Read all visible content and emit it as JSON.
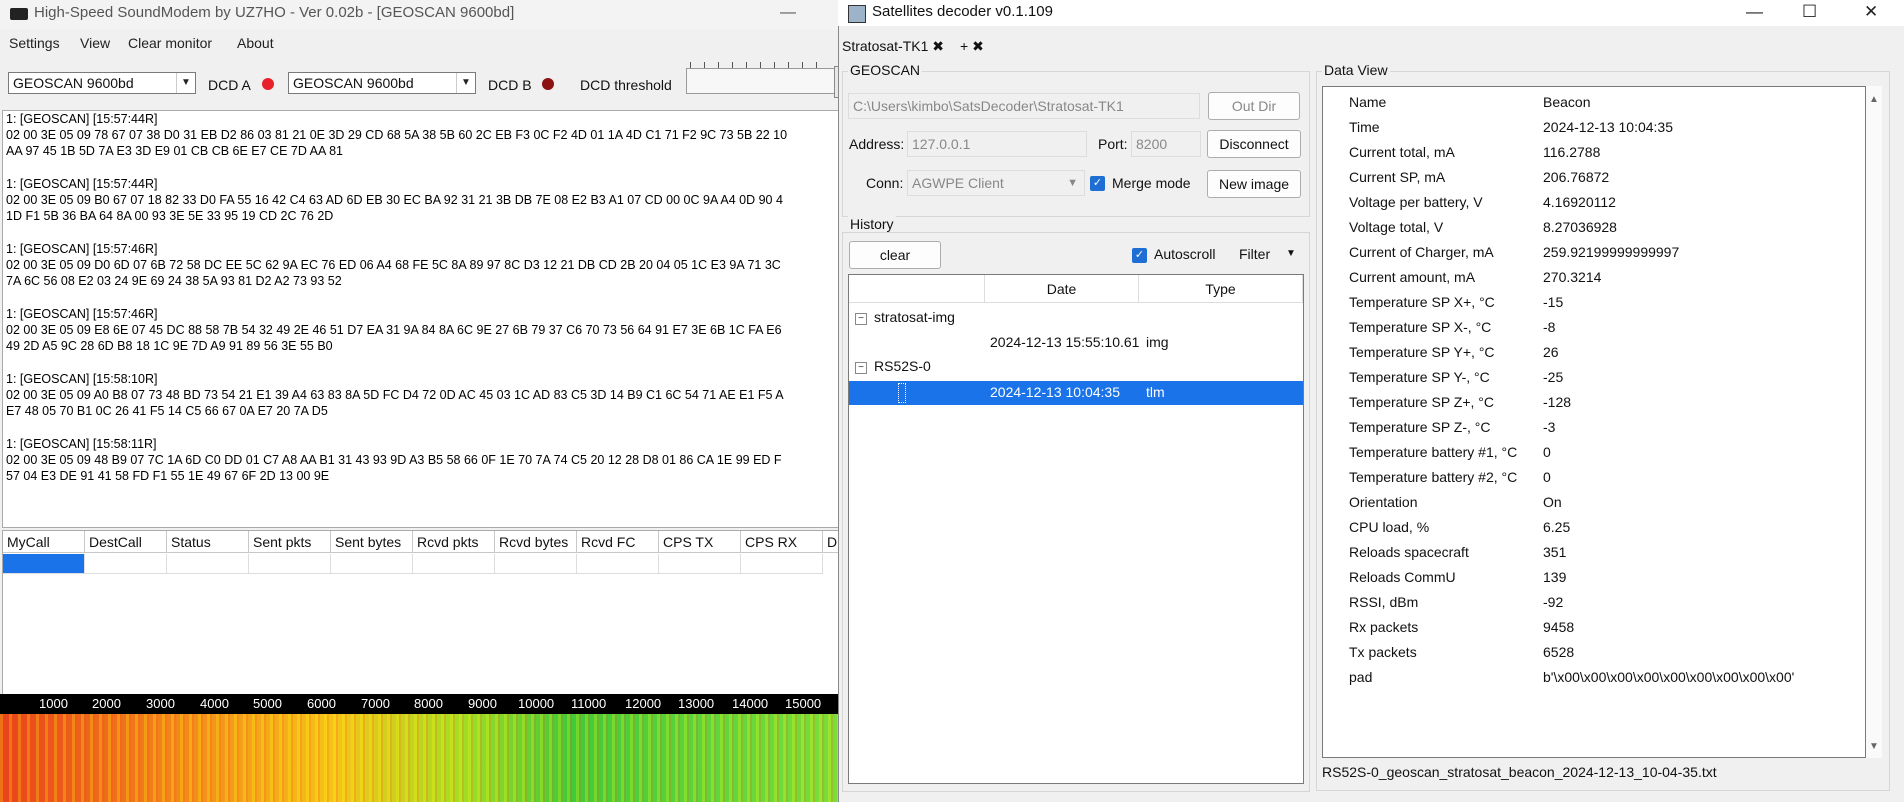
{
  "soundmodem": {
    "title": "High-Speed SoundModem by UZ7HO - Ver 0.02b - [GEOSCAN 9600bd]",
    "minimize": "—",
    "menu": [
      "Settings",
      "View",
      "Clear monitor",
      "About"
    ],
    "modem_a": "GEOSCAN 9600bd",
    "dcd_a_label": "DCD A",
    "modem_b": "GEOSCAN 9600bd",
    "dcd_b_label": "DCD B",
    "dcd_threshold_label": "DCD threshold",
    "led_a_color": "#e8202a",
    "led_b_color": "#8b1212",
    "monitor": [
      {
        "header": "1: [GEOSCAN] [15:57:44R]",
        "line1": "02 00 3E 05 09 78 67 07 38 D0 31 EB D2 86 03 81 21 0E 3D 29 CD 68 5A 38 5B 60 2C EB F3 0C F2 4D 01 1A 4D C1 71 F2 9C 73 5B 22 10",
        "line2": "AA 97 45 1B 5D 7A E3 3D E9 01 CB CB 6E E7 CE 7D AA 81"
      },
      {
        "header": "1: [GEOSCAN] [15:57:44R]",
        "line1": "02 00 3E 05 09 B0 67 07 18 82 33 D0 FA 55 16 42 C4 63 AD 6D EB 30 EC BA 92 31 21 3B DB 7E 08 E2 B3 A1 07 CD 00 0C 9A A4 0D 90 4",
        "line2": "1D F1 5B 36 BA 64 8A 00 93 3E 5E 33 95 19 CD 2C 76 2D"
      },
      {
        "header": "1: [GEOSCAN] [15:57:46R]",
        "line1": "02 00 3E 05 09 D0 6D 07 6B 72 58 DC EE 5C 62 9A EC 76 ED 06 A4 68 FE 5C 8A 89 97 8C D3 12 21 DB CD 2B 20 04 05 1C E3 9A 71 3C",
        "line2": "7A 6C 56 08 E2 03 24 9E 69 24 38 5A 93 81 D2 A2 73 93 52"
      },
      {
        "header": "1: [GEOSCAN] [15:57:46R]",
        "line1": "02 00 3E 05 09 E8 6E 07 45 DC 88 58 7B 54 32 49 2E 46 51 D7 EA 31 9A 84 8A 6C 9E 27 6B 79 37 C6 70 73 56 64 91 E7 3E 6B 1C FA E6",
        "line2": "49 2D A5 9C 28 6D B8 18 1C 9E 7D A9 91 89 56 3E 55 B0"
      },
      {
        "header": "1: [GEOSCAN] [15:58:10R]",
        "line1": "02 00 3E 05 09 A0 B8 07 73 48 BD 73 54 21 E1 39 A4 63 83 8A 5D FC D4 72 0D AC 45 03 1C AD 83 C5 3D 14 B9 C1 6C 54 71 AE E1 F5 A",
        "line2": "E7 48 05 70 B1 0C 26 41 F5 14 C5 66 67 0A E7 20 7A D5"
      },
      {
        "header": "1: [GEOSCAN] [15:58:11R]",
        "line1": "02 00 3E 05 09 48 B9 07 7C 1A 6D C0 DD 01 C7 A8 AA B1 31 43 93 9D A3 B5 58 66 0F 1E 70 7A 74 C5 20 12 28 D8 01 86 CA 1E 99 ED F",
        "line2": "57 04 E3 DE 91 41 58 FD F1 55 1E 49 67 6F 2D 13 00 9E"
      }
    ],
    "table_headers": [
      "MyCall",
      "DestCall",
      "Status",
      "Sent pkts",
      "Sent bytes",
      "Rcvd pkts",
      "Rcvd bytes",
      "Rcvd FC",
      "CPS TX",
      "CPS RX",
      "Dir"
    ],
    "ruler_ticks": [
      "1000",
      "2000",
      "3000",
      "4000",
      "5000",
      "6000",
      "7000",
      "8000",
      "9000",
      "10000",
      "11000",
      "12000",
      "13000",
      "14000",
      "15000"
    ]
  },
  "decoder": {
    "title": "Satellites decoder v0.1.109",
    "window_controls": {
      "minimize": "—",
      "maximize": "☐",
      "close": "✕"
    },
    "tab_label": "Stratosat-TK1",
    "tab_close": "✖",
    "tab_add": "+ ✖",
    "geoscan_group": "GEOSCAN",
    "out_dir_path": "C:\\Users\\kimbo\\SatsDecoder\\Stratosat-TK1",
    "out_dir_button": "Out Dir",
    "address_label": "Address:",
    "address_value": "127.0.0.1",
    "port_label": "Port:",
    "port_value": "8200",
    "disconnect_button": "Disconnect",
    "conn_label": "Conn:",
    "conn_value": "AGWPE Client",
    "merge_mode_label": "Merge mode",
    "merge_mode_checked": true,
    "new_image_button": "New image",
    "history_group": "History",
    "clear_button": "clear",
    "autoscroll_label": "Autoscroll",
    "autoscroll_checked": true,
    "filter_label": "Filter",
    "history_columns": [
      "Date",
      "Type"
    ],
    "history": [
      {
        "group": "stratosat-img",
        "items": [
          {
            "date": "2024-12-13 15:55:10.61",
            "type": "img"
          }
        ]
      },
      {
        "group": "RS52S-0",
        "items": [
          {
            "date": "2024-12-13 10:04:35",
            "type": "tlm",
            "selected": true
          }
        ]
      }
    ],
    "dataview_group": "Data View",
    "dataview": [
      {
        "key": "Name",
        "value": "Beacon"
      },
      {
        "key": "Time",
        "value": "2024-12-13 10:04:35"
      },
      {
        "key": "Current total, mA",
        "value": "116.2788"
      },
      {
        "key": "Current SP, mA",
        "value": "206.76872"
      },
      {
        "key": "Voltage per battery, V",
        "value": "4.16920112"
      },
      {
        "key": "Voltage total, V",
        "value": "8.27036928"
      },
      {
        "key": "Current of Charger, mA",
        "value": "259.92199999999997"
      },
      {
        "key": "Current amount, mA",
        "value": "270.3214"
      },
      {
        "key": "Temperature SP X+, °C",
        "value": "-15"
      },
      {
        "key": "Temperature SP X-, °C",
        "value": "-8"
      },
      {
        "key": "Temperature SP Y+, °C",
        "value": "26"
      },
      {
        "key": "Temperature SP Y-, °C",
        "value": "-25"
      },
      {
        "key": "Temperature SP Z+, °C",
        "value": "-128"
      },
      {
        "key": "Temperature SP Z-, °C",
        "value": "-3"
      },
      {
        "key": "Temperature battery #1, °C",
        "value": "0"
      },
      {
        "key": "Temperature battery #2, °C",
        "value": "0"
      },
      {
        "key": "Orientation",
        "value": "On"
      },
      {
        "key": "CPU load, %",
        "value": "6.25"
      },
      {
        "key": "Reloads spacecraft",
        "value": "351"
      },
      {
        "key": "Reloads CommU",
        "value": "139"
      },
      {
        "key": "RSSI, dBm",
        "value": "-92"
      },
      {
        "key": "Rx packets",
        "value": "9458"
      },
      {
        "key": "Tx packets",
        "value": "6528"
      },
      {
        "key": "pad",
        "value": "b'\\x00\\x00\\x00\\x00\\x00\\x00\\x00\\x00\\x00'"
      }
    ],
    "status_filename": "RS52S-0_geoscan_stratosat_beacon_2024-12-13_10-04-35.txt"
  }
}
